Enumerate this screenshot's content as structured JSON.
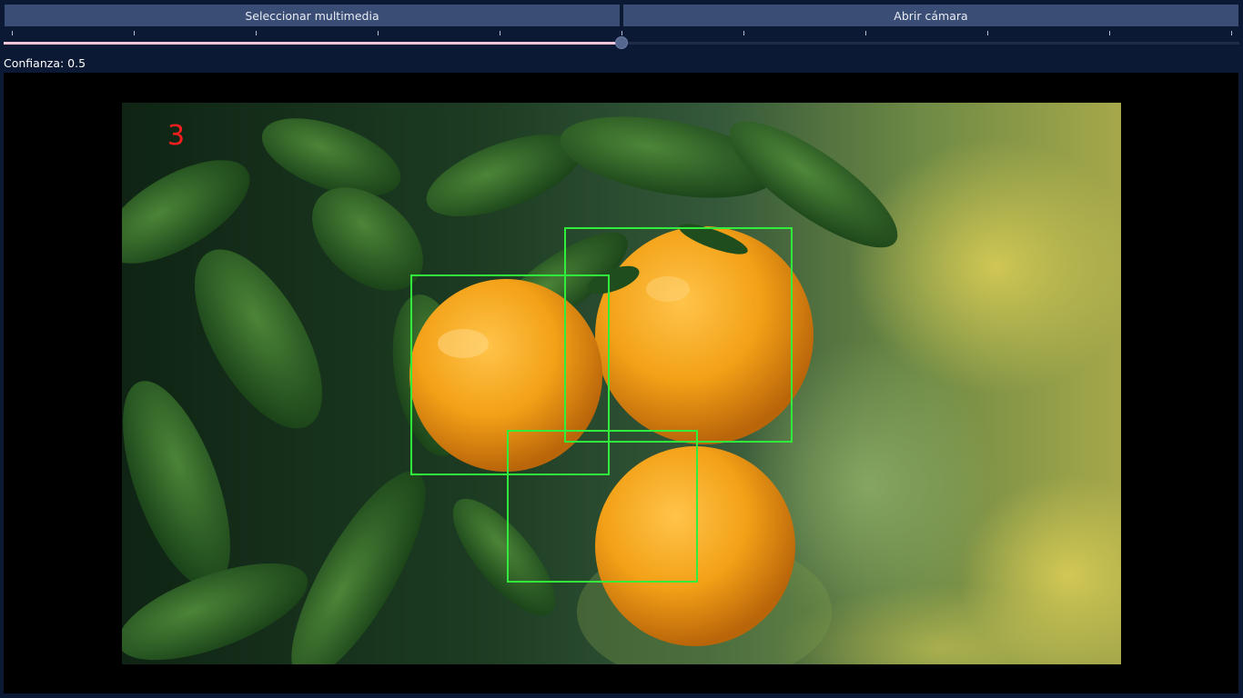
{
  "toolbar": {
    "select_media_label": "Seleccionar multimedia",
    "open_camera_label": "Abrir cámara"
  },
  "confidence": {
    "label": "Confianza: 0.5",
    "value": 0.5
  },
  "detections": {
    "count": "3",
    "count_color": "#ff1e1e",
    "box_color": "#31ee3c"
  },
  "colors": {
    "background": "#0b1934",
    "button": "#3a4d75",
    "slider_fill": "#f4c6d7"
  }
}
